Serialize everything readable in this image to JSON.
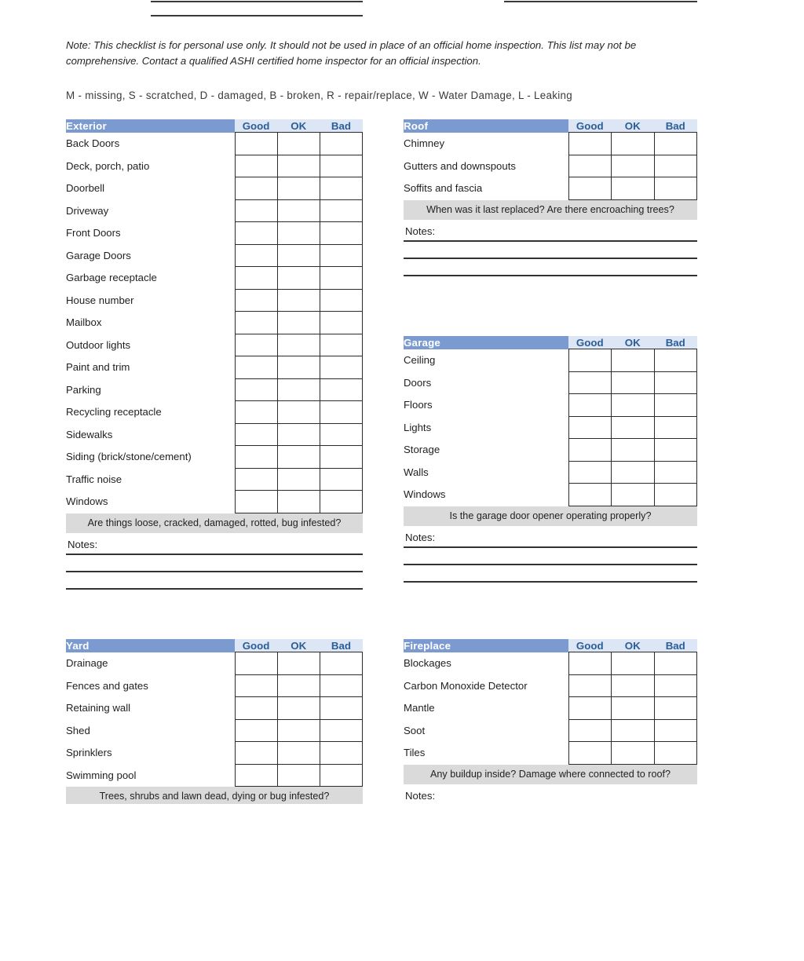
{
  "document": {
    "note": "Note: This checklist is for personal use only. It should not be used in place of an official home inspection. This list may not be comprehensive. Contact a qualified ASHI certified home inspector for an official inspection.",
    "legend": "M - missing,  S - scratched,  D - damaged,  B - broken,  R - repair/replace,  W - Water Damage,  L - Leaking",
    "rating_columns": [
      "Good",
      "OK",
      "Bad"
    ],
    "notes_label": "Notes:"
  },
  "colors": {
    "header_blue": "#7b9bd0",
    "rating_header_blue": "#dce6f4",
    "rating_header_text": "#2c5d96",
    "prompt_gray": "#dadada",
    "rule": "#333333",
    "cell_border": "#2b2b2b"
  },
  "sections": {
    "exterior": {
      "title": "Exterior",
      "items": [
        "Back Doors",
        "Deck, porch, patio",
        "Doorbell",
        "Driveway",
        "Front Doors",
        "Garage Doors",
        "Garbage receptacle",
        "House number",
        "Mailbox",
        "Outdoor lights",
        "Paint and trim",
        "Parking",
        "Recycling receptacle",
        "Sidewalks",
        "Siding (brick/stone/cement)",
        "Traffic noise",
        "Windows"
      ],
      "prompt": "Are things loose, cracked, damaged, rotted, bug infested?"
    },
    "roof": {
      "title": "Roof",
      "items": [
        "Chimney",
        "Gutters and downspouts",
        "Soffits and fascia"
      ],
      "prompt": "When was it last replaced? Are there encroaching trees?"
    },
    "garage": {
      "title": "Garage",
      "items": [
        "Ceiling",
        "Doors",
        "Floors",
        "Lights",
        "Storage",
        "Walls",
        "Windows"
      ],
      "prompt": "Is the garage door opener operating properly?"
    },
    "yard": {
      "title": "Yard",
      "items": [
        "Drainage",
        "Fences and gates",
        "Retaining wall",
        "Shed",
        "Sprinklers",
        "Swimming pool"
      ],
      "prompt": "Trees, shrubs and lawn dead, dying or bug infested?"
    },
    "fireplace": {
      "title": "Fireplace",
      "items": [
        "Blockages",
        "Carbon Monoxide Detector",
        "Mantle",
        "Soot",
        "Tiles"
      ],
      "prompt": "Any buildup inside? Damage where connected to roof?"
    }
  }
}
